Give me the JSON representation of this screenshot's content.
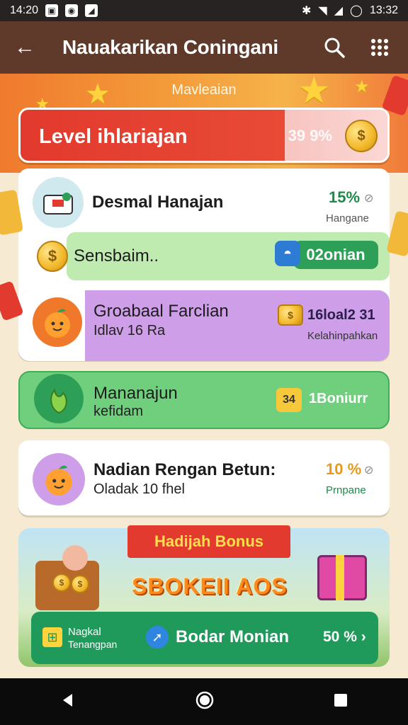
{
  "status": {
    "time": "14:20",
    "time_right": "13:32"
  },
  "appbar": {
    "title": "Nauakarikan Coningani"
  },
  "hero": {
    "subtitle": "Mavleaian"
  },
  "level": {
    "label": "Level ihlariajan",
    "value": "39 9%"
  },
  "cards": {
    "desmal": {
      "title": "Desmal Hanajan",
      "pct": "15%",
      "tag": "Hangane"
    },
    "sensbaim": {
      "title": "Sensbaim..",
      "button": "02onian"
    },
    "groabaal": {
      "title": "Groabaal Farclian",
      "sub": "Idlav 16 Ra",
      "reward": "16loal2 31",
      "tag": "Kelahinpahkan"
    },
    "mananajun": {
      "title": "Mananajun",
      "sub": "kefidam",
      "badge": "34",
      "reward": "1Boniurr"
    },
    "nadian": {
      "title": "Nadian Rengan Betun:",
      "sub": "Oladak 10 fhel",
      "pct": "10 %",
      "tag": "Prnpane"
    }
  },
  "bonus": {
    "ribbon": "Hadijah Bonus",
    "headline": "SBOKEII AOS",
    "left_label1": "Nagkal",
    "left_label2": "Tenangpan",
    "center_label": "Bodar Monian",
    "right_label": "50 % ›"
  },
  "colors": {
    "appbar": "#5f3a2b",
    "accent_red": "#e23a2e",
    "accent_green": "#1f9a5a",
    "purple": "#cf9ee9"
  }
}
